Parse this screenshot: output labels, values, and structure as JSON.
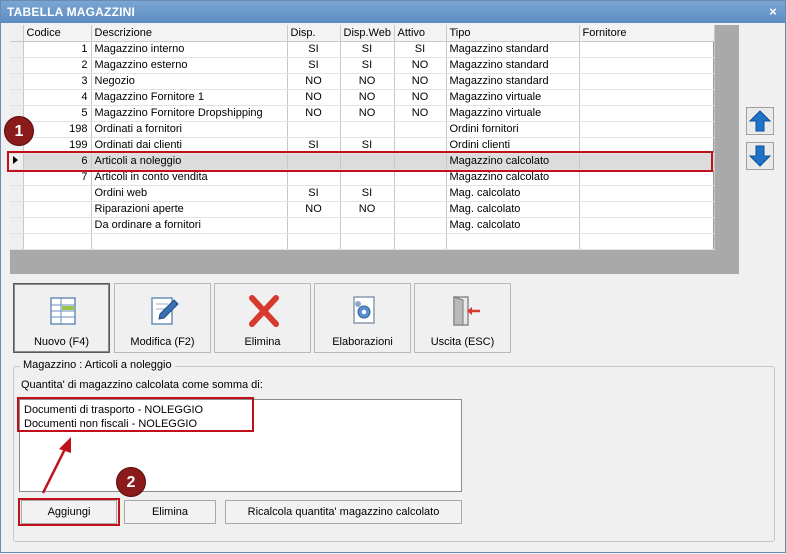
{
  "window": {
    "title": "TABELLA MAGAZZINI",
    "close_glyph": "×"
  },
  "columns": [
    "Codice",
    "Descrizione",
    "Disp.",
    "Disp.Web",
    "Attivo",
    "Tipo",
    "Fornitore"
  ],
  "rows": [
    {
      "codice": "1",
      "descrizione": "Magazzino interno",
      "disp": "SI",
      "dispweb": "SI",
      "attivo": "SI",
      "tipo": "Magazzino standard",
      "fornitore": ""
    },
    {
      "codice": "2",
      "descrizione": "Magazzino esterno",
      "disp": "SI",
      "dispweb": "SI",
      "attivo": "NO",
      "tipo": "Magazzino standard",
      "fornitore": ""
    },
    {
      "codice": "3",
      "descrizione": "Negozio",
      "disp": "NO",
      "dispweb": "NO",
      "attivo": "NO",
      "tipo": "Magazzino standard",
      "fornitore": ""
    },
    {
      "codice": "4",
      "descrizione": "Magazzino Fornitore 1",
      "disp": "NO",
      "dispweb": "NO",
      "attivo": "NO",
      "tipo": "Magazzino virtuale",
      "fornitore": ""
    },
    {
      "codice": "5",
      "descrizione": "Magazzino Fornitore Dropshipping",
      "disp": "NO",
      "dispweb": "NO",
      "attivo": "NO",
      "tipo": "Magazzino virtuale",
      "fornitore": ""
    },
    {
      "codice": "198",
      "descrizione": "Ordinati a fornitori",
      "disp": "",
      "dispweb": "",
      "attivo": "",
      "tipo": "Ordini fornitori",
      "fornitore": ""
    },
    {
      "codice": "199",
      "descrizione": "Ordinati dai clienti",
      "disp": "SI",
      "dispweb": "SI",
      "attivo": "",
      "tipo": "Ordini clienti",
      "fornitore": ""
    },
    {
      "codice": "6",
      "descrizione": "Articoli a noleggio",
      "disp": "",
      "dispweb": "",
      "attivo": "",
      "tipo": "Magazzino calcolato",
      "fornitore": ""
    },
    {
      "codice": "7",
      "descrizione": "Articoli in conto vendita",
      "disp": "",
      "dispweb": "",
      "attivo": "",
      "tipo": "Magazzino calcolato",
      "fornitore": ""
    },
    {
      "codice": "",
      "descrizione": "Ordini web",
      "disp": "SI",
      "dispweb": "SI",
      "attivo": "",
      "tipo": "Mag. calcolato",
      "fornitore": ""
    },
    {
      "codice": "",
      "descrizione": "Riparazioni aperte",
      "disp": "NO",
      "dispweb": "NO",
      "attivo": "",
      "tipo": "Mag. calcolato",
      "fornitore": ""
    },
    {
      "codice": "",
      "descrizione": "Da ordinare a fornitori",
      "disp": "",
      "dispweb": "",
      "attivo": "",
      "tipo": "Mag. calcolato",
      "fornitore": ""
    },
    {
      "codice": "",
      "descrizione": "",
      "disp": "",
      "dispweb": "",
      "attivo": "",
      "tipo": "",
      "fornitore": ""
    }
  ],
  "selected_row_index": 7,
  "toolbar": {
    "nuovo": "Nuovo (F4)",
    "modifica": "Modifica (F2)",
    "elimina": "Elimina",
    "elaborazioni": "Elaborazioni",
    "uscita": "Uscita (ESC)"
  },
  "group": {
    "title": "Magazzino : Articoli a noleggio",
    "description": "Quantita' di magazzino calcolata come somma di:",
    "list_items": [
      "Documenti di trasporto - NOLEGGIO",
      "Documenti non fiscali - NOLEGGIO"
    ],
    "buttons": {
      "aggiungi": "Aggiungi",
      "elimina": "Elimina",
      "ricalcola": "Ricalcola quantita' magazzino calcolato"
    }
  },
  "callouts": {
    "badge1": "1",
    "badge2": "2"
  },
  "colors": {
    "titlebar": "#5b8cc1",
    "highlight": "#c0101a",
    "badge": "#8b1a1a",
    "arrow_blue": "#1e73c8"
  },
  "icons": {
    "up": "arrow-up-icon",
    "down": "arrow-down-icon",
    "nuovo": "new-table-icon",
    "modifica": "edit-document-icon",
    "elimina": "delete-x-icon",
    "elaborazioni": "gear-document-icon",
    "uscita": "exit-door-icon"
  }
}
